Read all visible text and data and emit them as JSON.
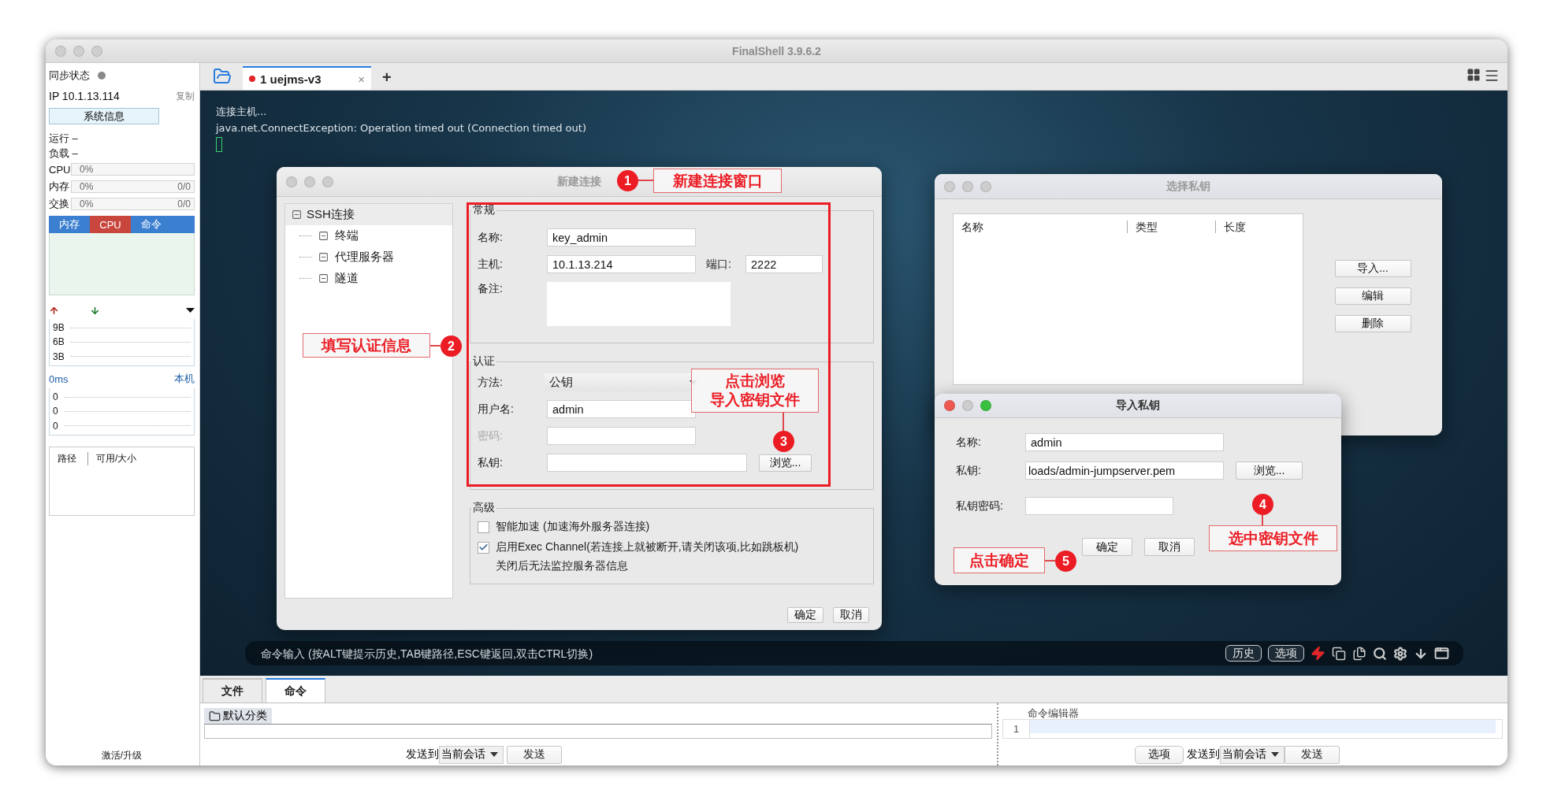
{
  "window": {
    "title": "FinalShell 3.9.6.2"
  },
  "sidebar": {
    "sync_status": "同步状态",
    "ip": "IP 10.1.13.114",
    "copy_link": "复制",
    "sysinfo_button": "系统信息",
    "stats": [
      "运行 –",
      "负载 –"
    ],
    "meters": [
      {
        "label": "CPU",
        "value": "0%",
        "level": 0
      },
      {
        "label": "内存",
        "value": "0%",
        "count": "0/0",
        "level": 0
      },
      {
        "label": "交换",
        "value": "0%",
        "count": "0/0",
        "level": 0
      }
    ],
    "monitor_tabs": [
      {
        "label": "内存",
        "selected": false
      },
      {
        "label": "CPU",
        "selected": true
      },
      {
        "label": "命令",
        "selected": false
      }
    ],
    "traffic_axis": [
      "9B",
      "6B",
      "3B"
    ],
    "latency": {
      "value": "0ms",
      "host": "本机",
      "axis": [
        "0",
        "0",
        "0"
      ]
    },
    "disk_columns": [
      "路径",
      "可用/大小"
    ],
    "footer_link": "激活/升级"
  },
  "session_tabs": [
    {
      "label": "1 uejms-v3",
      "selected": true,
      "close": "×"
    }
  ],
  "new_tab_button": "+",
  "terminal": {
    "lines": [
      "连接主机...",
      "java.net.ConnectException: Operation timed out (Connection timed out)"
    ]
  },
  "command_bar": {
    "placeholder": "命令输入 (按ALT键提示历史,TAB键路径,ESC键返回,双击CTRL切换)",
    "buttons": [
      "历史",
      "选项"
    ]
  },
  "new_connection_dialog": {
    "title": "新建连接",
    "tree": {
      "label": "SSH连接",
      "selected": true,
      "children": [
        {
          "label": "终端",
          "selected": false
        },
        {
          "label": "代理服务器",
          "selected": false
        },
        {
          "label": "隧道",
          "selected": false
        }
      ]
    },
    "general": {
      "legend": "常规",
      "name_label": "名称:",
      "name": "key_admin",
      "host_label": "主机:",
      "host": "10.1.13.214",
      "port_label": "端口:",
      "port": "2222",
      "note_label": "备注:"
    },
    "auth": {
      "legend": "认证",
      "method_label": "方法:",
      "method": "公钥",
      "user_label": "用户名:",
      "user": "admin",
      "password_label": "密码:",
      "password_disabled": true,
      "key_label": "私钥:",
      "browse_button": "浏览..."
    },
    "advanced": {
      "legend": "高级",
      "options": [
        {
          "label": "智能加速 (加速海外服务器连接)",
          "checked": false
        },
        {
          "label": "启用Exec Channel(若连接上就被断开,请关闭该项,比如跳板机)",
          "checked": true
        }
      ],
      "note": "关闭后无法监控服务器信息"
    },
    "buttons": [
      "确定",
      "取消"
    ]
  },
  "key_chooser_dialog": {
    "title": "选择私钥",
    "columns": [
      "名称",
      "类型",
      "长度"
    ],
    "buttons": [
      "导入...",
      "编辑",
      "删除"
    ]
  },
  "import_key_dialog": {
    "title": "导入私钥",
    "name_label": "名称:",
    "name": "admin",
    "key_label": "私钥:",
    "key": "loads/admin-jumpserver.pem",
    "browse_button": "浏览...",
    "passphrase_label": "私钥密码:",
    "buttons": [
      "确定",
      "取消"
    ]
  },
  "annotations": [
    {
      "number": "1",
      "lines": [
        "新建连接窗口"
      ]
    },
    {
      "number": "2",
      "lines": [
        "填写认证信息"
      ]
    },
    {
      "number": "3",
      "lines": [
        "点击浏览",
        "导入密钥文件"
      ]
    },
    {
      "number": "4",
      "lines": [
        "选中密钥文件"
      ]
    },
    {
      "number": "5",
      "lines": [
        "点击确定"
      ]
    }
  ],
  "bottom_panel": {
    "tabs": [
      {
        "label": "文件",
        "selected": false
      },
      {
        "label": "命令",
        "selected": true
      }
    ],
    "category": "默认分类",
    "send_to_label": "发送到",
    "session": "当前会话",
    "send_button": "发送",
    "editor_title": "命令编辑器",
    "line_number": "1",
    "options_button": "选项",
    "editor_send_to_label": "发送到",
    "editor_session": "当前会话",
    "editor_send_button": "发送"
  }
}
